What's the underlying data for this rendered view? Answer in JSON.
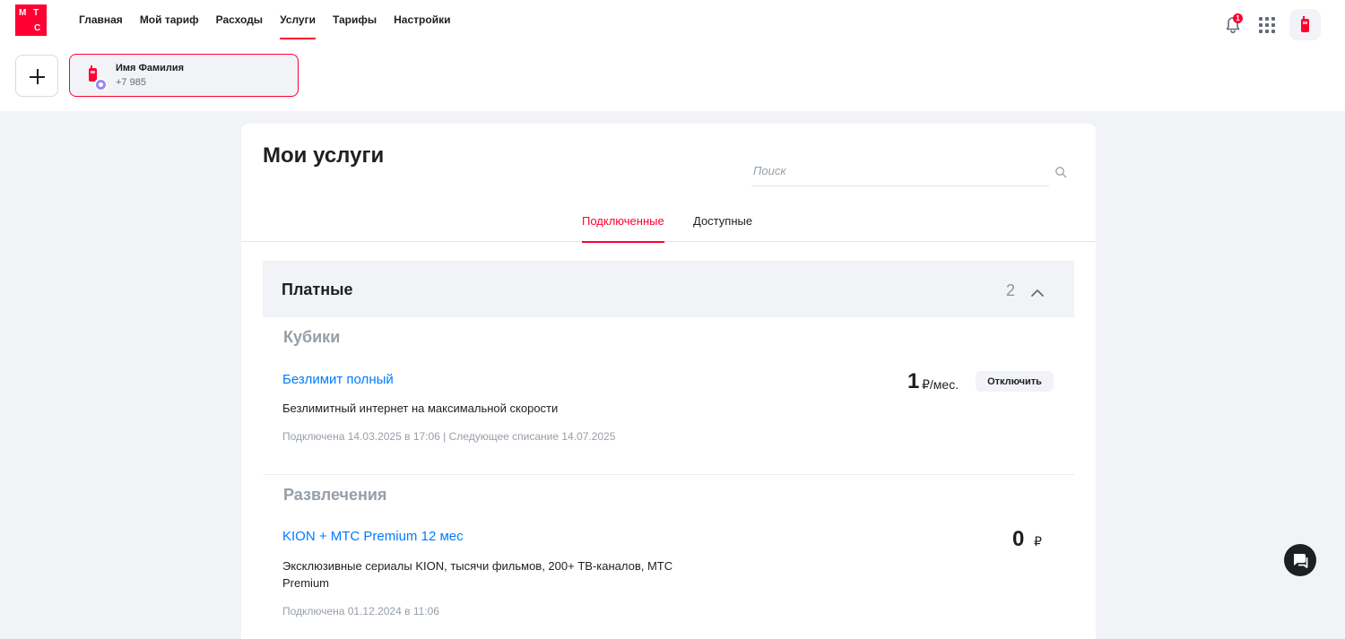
{
  "brand": {
    "logo_letters": [
      "М",
      "Т",
      "С"
    ],
    "accent": "#ff0032"
  },
  "nav": {
    "items": [
      {
        "label": "Главная",
        "active": false
      },
      {
        "label": "Мой тариф",
        "active": false
      },
      {
        "label": "Расходы",
        "active": false
      },
      {
        "label": "Услуги",
        "active": true
      },
      {
        "label": "Тарифы",
        "active": false
      },
      {
        "label": "Настройки",
        "active": false
      }
    ]
  },
  "header": {
    "notifications_count": "1",
    "icons": [
      "bell-icon",
      "apps-grid-icon",
      "phone-icon"
    ]
  },
  "account": {
    "name": "Имя Фамилия",
    "phone": "+7 985"
  },
  "main": {
    "title": "Мои услуги",
    "search": {
      "placeholder": "Поиск",
      "value": ""
    },
    "tabs": [
      {
        "label": "Подключенные",
        "active": true
      },
      {
        "label": "Доступные",
        "active": false
      }
    ],
    "section": {
      "title": "Платные",
      "count": "2",
      "expanded": true
    },
    "groups": [
      {
        "category": "Кубики",
        "service": {
          "name": "Безлимит полный",
          "description": "Безлимитный интернет на максимальной скорости",
          "meta": "Подключена 14.03.2025 в 17:06 | Следующее списание 14.07.2025",
          "price": "1",
          "price_unit": "₽/мес.",
          "action_label": "Отключить"
        }
      },
      {
        "category": "Развлечения",
        "service": {
          "name": "KION + МТС Premium 12 мес",
          "description": "Эксклюзивные сериалы KION, тысячи фильмов, 200+ ТВ-каналов, МТС Premium",
          "meta": "Подключена 01.12.2024 в 11:06",
          "price": "0",
          "price_unit": "₽"
        }
      }
    ]
  },
  "colors": {
    "accent": "#ff0032",
    "link": "#007cff",
    "muted": "#969fa8",
    "background": "#f2f3f7"
  }
}
